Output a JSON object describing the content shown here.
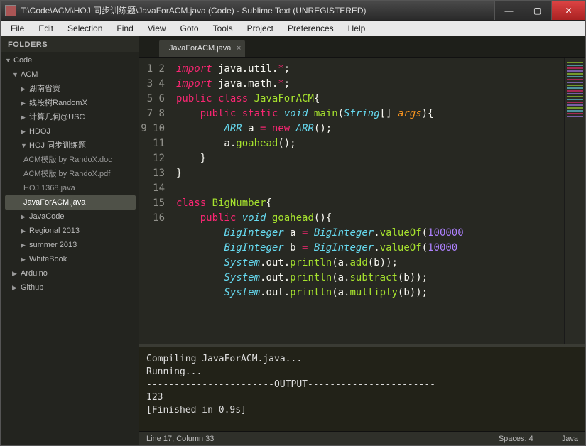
{
  "title": "T:\\Code\\ACM\\HOJ 同步训练题\\JavaForACM.java (Code) - Sublime Text (UNREGISTERED)",
  "menu": [
    "File",
    "Edit",
    "Selection",
    "Find",
    "View",
    "Goto",
    "Tools",
    "Project",
    "Preferences",
    "Help"
  ],
  "sidebar": {
    "header": "FOLDERS",
    "nodes": [
      {
        "label": "Code",
        "open": true,
        "depth": 0
      },
      {
        "label": "ACM",
        "open": true,
        "depth": 1
      },
      {
        "label": "湖南省赛",
        "open": false,
        "depth": 2
      },
      {
        "label": "线段树RandomX",
        "open": false,
        "depth": 2
      },
      {
        "label": "计算几何@USC",
        "open": false,
        "depth": 2
      },
      {
        "label": "HDOJ",
        "open": false,
        "depth": 2
      },
      {
        "label": "HOJ 同步训练题",
        "open": true,
        "depth": 2
      },
      {
        "label": "ACM模版 by RandoX.doc",
        "file": true,
        "depth": 3
      },
      {
        "label": "ACM模版 by RandoX.pdf",
        "file": true,
        "depth": 3
      },
      {
        "label": "HOJ 1368.java",
        "file": true,
        "depth": 3
      },
      {
        "label": "JavaForACM.java",
        "file": true,
        "depth": 3,
        "selected": true
      },
      {
        "label": "JavaCode",
        "open": false,
        "depth": 2
      },
      {
        "label": "Regional 2013",
        "open": false,
        "depth": 2
      },
      {
        "label": "summer 2013",
        "open": false,
        "depth": 2
      },
      {
        "label": "WhiteBook",
        "open": false,
        "depth": 2
      },
      {
        "label": "Arduino",
        "open": false,
        "depth": 1
      },
      {
        "label": "Github",
        "open": false,
        "depth": 1
      }
    ]
  },
  "tab": {
    "label": "JavaForACM.java"
  },
  "gutter_start": 1,
  "gutter_end": 16,
  "code_lines": [
    [
      [
        "kw",
        "import"
      ],
      [
        "p",
        " java"
      ],
      [
        "p",
        "."
      ],
      [
        "p",
        "util"
      ],
      [
        "p",
        "."
      ],
      [
        "op",
        "*"
      ],
      [
        "p",
        ";"
      ]
    ],
    [
      [
        "kw",
        "import"
      ],
      [
        "p",
        " java"
      ],
      [
        "p",
        "."
      ],
      [
        "p",
        "math"
      ],
      [
        "p",
        "."
      ],
      [
        "op",
        "*"
      ],
      [
        "p",
        ";"
      ]
    ],
    [
      [
        "kw2",
        "public"
      ],
      [
        "p",
        " "
      ],
      [
        "kw2",
        "class"
      ],
      [
        "p",
        " "
      ],
      [
        "cls",
        "JavaForACM"
      ],
      [
        "p",
        "{"
      ]
    ],
    [
      [
        "p",
        "    "
      ],
      [
        "kw2",
        "public"
      ],
      [
        "p",
        " "
      ],
      [
        "kw2",
        "static"
      ],
      [
        "p",
        " "
      ],
      [
        "ty",
        "void"
      ],
      [
        "p",
        " "
      ],
      [
        "fn",
        "main"
      ],
      [
        "p",
        "("
      ],
      [
        "ty",
        "String"
      ],
      [
        "p",
        "[] "
      ],
      [
        "par",
        "args"
      ],
      [
        "p",
        "){"
      ]
    ],
    [
      [
        "p",
        "        "
      ],
      [
        "ty",
        "ARR"
      ],
      [
        "p",
        " a "
      ],
      [
        "op",
        "="
      ],
      [
        "p",
        " "
      ],
      [
        "kw2",
        "new"
      ],
      [
        "p",
        " "
      ],
      [
        "ty",
        "ARR"
      ],
      [
        "p",
        "();"
      ]
    ],
    [
      [
        "p",
        "        a"
      ],
      [
        "p",
        "."
      ],
      [
        "fn",
        "goahead"
      ],
      [
        "p",
        "();"
      ]
    ],
    [
      [
        "p",
        "    }"
      ]
    ],
    [
      [
        "p",
        "}"
      ]
    ],
    [],
    [
      [
        "kw2",
        "class"
      ],
      [
        "p",
        " "
      ],
      [
        "cls",
        "BigNumber"
      ],
      [
        "p",
        "{"
      ]
    ],
    [
      [
        "p",
        "    "
      ],
      [
        "kw2",
        "public"
      ],
      [
        "p",
        " "
      ],
      [
        "ty",
        "void"
      ],
      [
        "p",
        " "
      ],
      [
        "fn",
        "goahead"
      ],
      [
        "p",
        "(){"
      ]
    ],
    [
      [
        "p",
        "        "
      ],
      [
        "ty",
        "BigInteger"
      ],
      [
        "p",
        " a "
      ],
      [
        "op",
        "="
      ],
      [
        "p",
        " "
      ],
      [
        "ty",
        "BigInteger"
      ],
      [
        "p",
        "."
      ],
      [
        "fn",
        "valueOf"
      ],
      [
        "p",
        "("
      ],
      [
        "num",
        "100000"
      ]
    ],
    [
      [
        "p",
        "        "
      ],
      [
        "ty",
        "BigInteger"
      ],
      [
        "p",
        " b "
      ],
      [
        "op",
        "="
      ],
      [
        "p",
        " "
      ],
      [
        "ty",
        "BigInteger"
      ],
      [
        "p",
        "."
      ],
      [
        "fn",
        "valueOf"
      ],
      [
        "p",
        "("
      ],
      [
        "num",
        "10000"
      ]
    ],
    [
      [
        "p",
        "        "
      ],
      [
        "ty",
        "System"
      ],
      [
        "p",
        ".out."
      ],
      [
        "fn",
        "println"
      ],
      [
        "p",
        "(a."
      ],
      [
        "fn",
        "add"
      ],
      [
        "p",
        "(b));"
      ]
    ],
    [
      [
        "p",
        "        "
      ],
      [
        "ty",
        "System"
      ],
      [
        "p",
        ".out."
      ],
      [
        "fn",
        "println"
      ],
      [
        "p",
        "(a."
      ],
      [
        "fn",
        "subtract"
      ],
      [
        "p",
        "(b));"
      ]
    ],
    [
      [
        "p",
        "        "
      ],
      [
        "ty",
        "System"
      ],
      [
        "p",
        ".out."
      ],
      [
        "fn",
        "println"
      ],
      [
        "p",
        "(a."
      ],
      [
        "fn",
        "multiply"
      ],
      [
        "p",
        "(b));"
      ]
    ]
  ],
  "console": "Compiling JavaForACM.java...\nRunning...\n-----------------------OUTPUT-----------------------\n123\n[Finished in 0.9s]",
  "status": {
    "left": "Line 17, Column 33",
    "spaces": "Spaces: 4",
    "lang": "Java"
  }
}
